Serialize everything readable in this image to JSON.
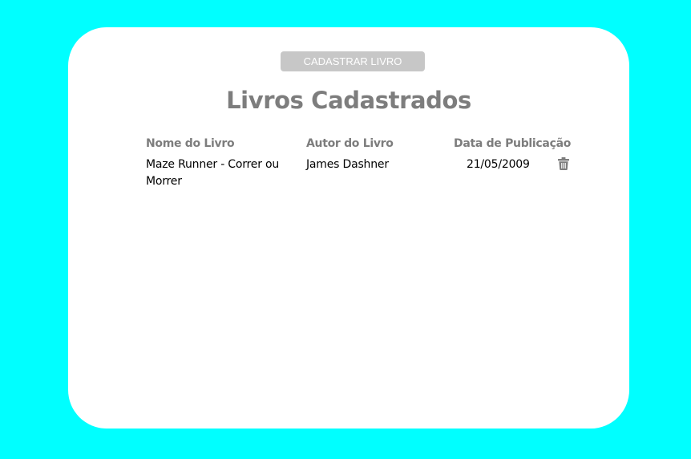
{
  "toolbar": {
    "add_book_label": "CADASTRAR LIVRO"
  },
  "page": {
    "title": "Livros Cadastrados"
  },
  "table": {
    "headers": {
      "name": "Nome do Livro",
      "author": "Autor do Livro",
      "date": "Data de Publicação"
    },
    "rows": [
      {
        "name": "Maze Runner - Correr ou Morrer",
        "author": "James Dashner",
        "date": "21/05/2009",
        "action_icon": "trash-icon"
      }
    ]
  },
  "colors": {
    "background": "#00ffff",
    "card": "#ffffff",
    "button": "#c7c7c7",
    "heading": "#7d7d7d",
    "text": "#000000"
  }
}
